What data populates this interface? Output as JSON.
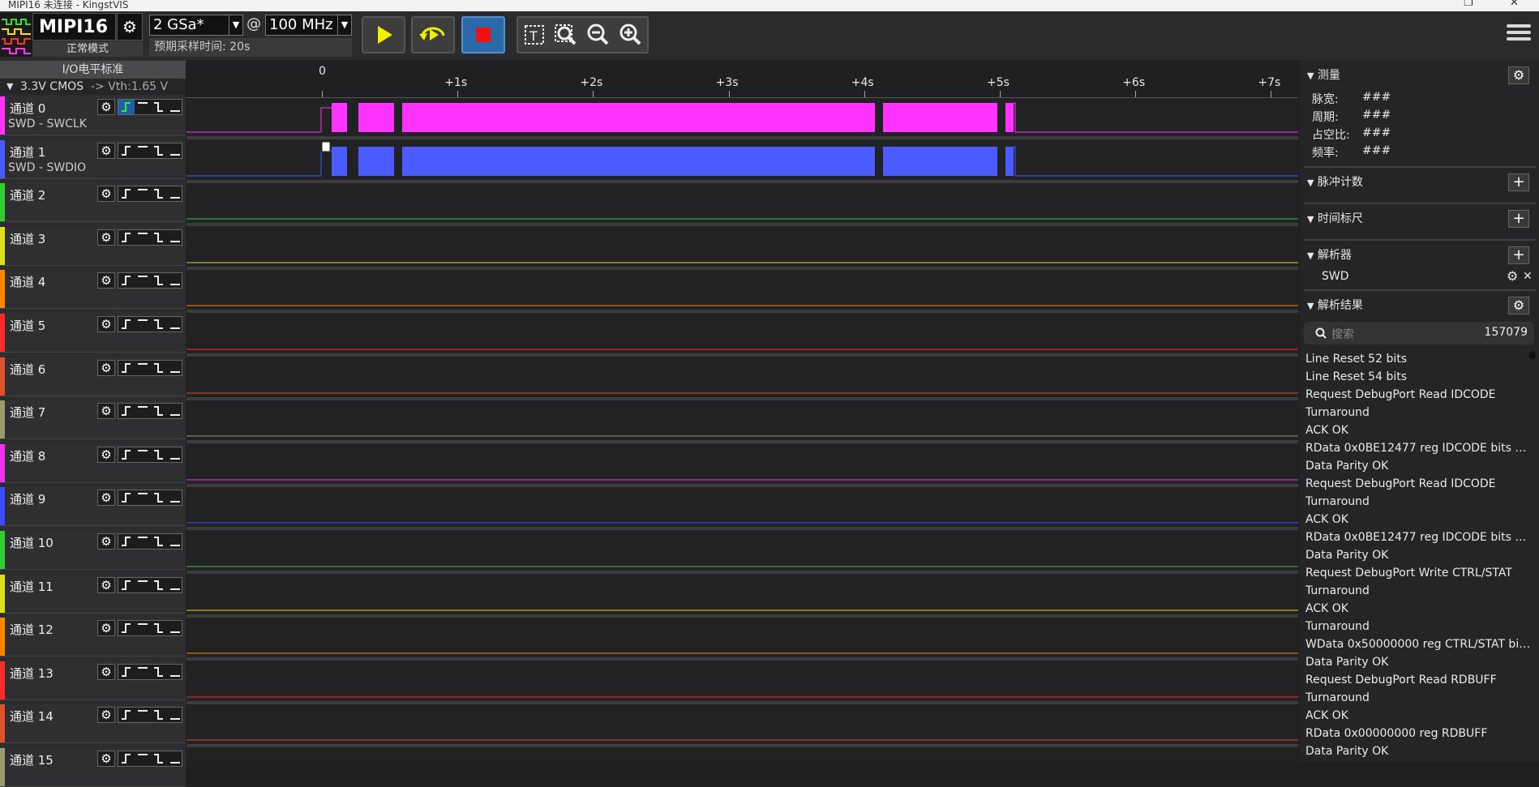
{
  "window": {
    "title": "MIPI16 未连接 - KingstVIS"
  },
  "device": {
    "name": "MIPI16",
    "mode": "正常模式"
  },
  "sample": {
    "rate": "2 GSa*",
    "at": "@",
    "freq": "100 MHz",
    "expected_time": "预期采样时间: 20s"
  },
  "io": {
    "header": "I/O电平标准",
    "standard": "3.3V CMOS",
    "threshold": "-> Vth:1.65 V"
  },
  "ruler": {
    "ticks": [
      "0",
      "+1s",
      "+2s",
      "+3s",
      "+4s",
      "+5s",
      "+6s",
      "+7s"
    ]
  },
  "channels": [
    {
      "name": "通道 0",
      "sub": "SWD - SWCLK",
      "color": "#ff33ff"
    },
    {
      "name": "通道 1",
      "sub": "SWD - SWDIO",
      "color": "#4a5cff"
    },
    {
      "name": "通道 2",
      "sub": "",
      "color": "#33cc33"
    },
    {
      "name": "通道 3",
      "sub": "",
      "color": "#dddd22"
    },
    {
      "name": "通道 4",
      "sub": "",
      "color": "#ff8800"
    },
    {
      "name": "通道 5",
      "sub": "",
      "color": "#ff2a2a"
    },
    {
      "name": "通道 6",
      "sub": "",
      "color": "#e0502a"
    },
    {
      "name": "通道 7",
      "sub": "",
      "color": "#9a9a6a"
    },
    {
      "name": "通道 8",
      "sub": "",
      "color": "#ee33ee"
    },
    {
      "name": "通道 9",
      "sub": "",
      "color": "#3b4cff"
    },
    {
      "name": "通道 10",
      "sub": "",
      "color": "#33cc33"
    },
    {
      "name": "通道 11",
      "sub": "",
      "color": "#dddd22"
    },
    {
      "name": "通道 12",
      "sub": "",
      "color": "#ff8800"
    },
    {
      "name": "通道 13",
      "sub": "",
      "color": "#ff2a2a"
    },
    {
      "name": "通道 14",
      "sub": "",
      "color": "#e0502a"
    },
    {
      "name": "通道 15",
      "sub": "",
      "color": "#9a9a6a"
    }
  ],
  "panel": {
    "measure": {
      "title": "测量",
      "width_label": "脉宽:",
      "width_val": "###",
      "period_label": "周期:",
      "period_val": "###",
      "duty_label": "占空比:",
      "duty_val": "###",
      "freq_label": "频率:",
      "freq_val": "###"
    },
    "pulse_count": "脉冲计数",
    "time_ruler": "时间标尺",
    "analyzers": {
      "title": "解析器",
      "item": "SWD"
    },
    "results": {
      "title": "解析结果",
      "search_placeholder": "搜索",
      "count": "157079",
      "items": [
        "Line Reset 52 bits",
        "Line Reset 54 bits",
        "Request DebugPort Read IDCODE",
        "Turnaround",
        "ACK OK",
        "RData 0x0BE12477 reg IDCODE bits DE...",
        "Data Parity OK",
        "Request DebugPort Read IDCODE",
        "Turnaround",
        "ACK OK",
        "RData 0x0BE12477 reg IDCODE bits DE...",
        "Data Parity OK",
        "Request DebugPort Write CTRL/STAT",
        "Turnaround",
        "ACK OK",
        "Turnaround",
        "WData 0x50000000 reg CTRL/STAT bits...",
        "Data Parity OK",
        "Request DebugPort Read RDBUFF",
        "Turnaround",
        "ACK OK",
        "RData 0x00000000 reg RDBUFF",
        "Data Parity OK"
      ]
    }
  }
}
